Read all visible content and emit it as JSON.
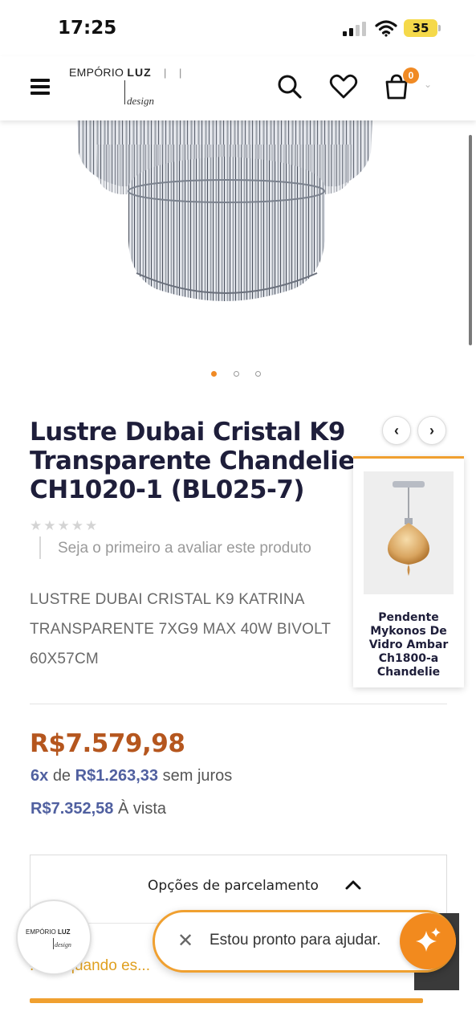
{
  "status_bar": {
    "time": "17:25",
    "battery": "35"
  },
  "header": {
    "logo_main_prefix": "EMPÓRIO",
    "logo_main_bold": "LUZ",
    "logo_bars": "| |",
    "logo_sub": "design",
    "cart_count": "0",
    "icons": [
      "menu-icon",
      "search-icon",
      "heart-icon",
      "cart-icon"
    ]
  },
  "gallery": {
    "slide_count": 3,
    "active_slide": 1,
    "dots": [
      "•",
      "•",
      "•"
    ]
  },
  "product": {
    "title": "Lustre Dubai Cristal K9\nTransparente Chandelie\nCH1020-1 (BL025-7)",
    "stars": "★★★★★",
    "rating_cta": "Seja o primeiro a avaliar este produto",
    "description": "LUSTRE DUBAI CRISTAL K9 KATRINA TRANSPARENTE 7XG9 MAX 40W BIVOLT 60X57CM"
  },
  "related": {
    "prev_label": "‹",
    "next_label": "›",
    "name": "Pendente Mykonos De Vidro Ambar Ch1800-a Chandelie"
  },
  "prices": {
    "main": "R$7.579,98",
    "installment_count": "6x",
    "installment_prefix": "de",
    "installment_value": "R$1.263,33",
    "installment_suffix": "sem juros",
    "cash_value": "R$7.352,58",
    "cash_suffix": "À vista"
  },
  "installment_options": {
    "label": "Opções de parcelamento",
    "notify_text": "...ise quando es..."
  },
  "chat": {
    "logo_main_prefix": "EMPÓRIO",
    "logo_main_bold": "LUZ",
    "logo_sub": "design",
    "close_label": "✕",
    "message": "Estou pronto para ajudar."
  },
  "colors": {
    "price": "#b5561e",
    "accent": "#f0a030",
    "installment_highlight": "#5060a0",
    "fab": "#f28a1e"
  }
}
